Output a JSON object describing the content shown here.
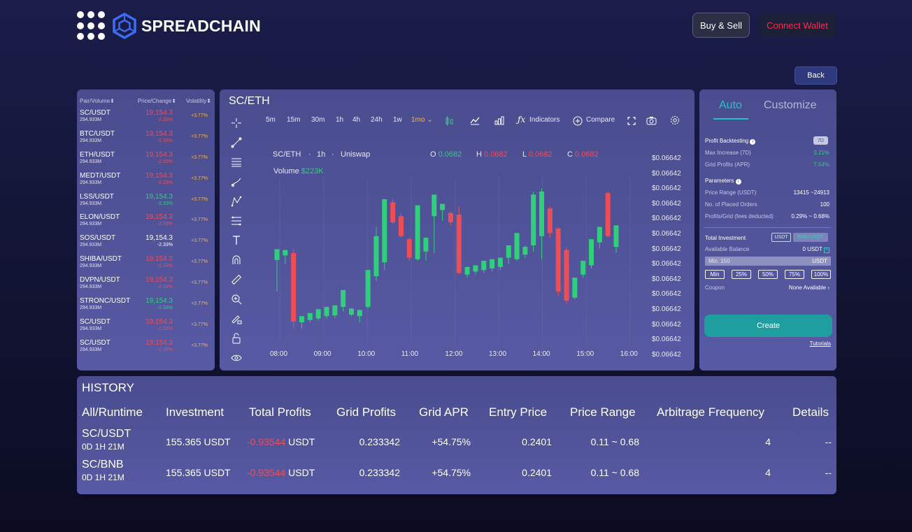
{
  "brand": {
    "name": "SPREADCHAIN"
  },
  "header": {
    "buy_sell": "Buy & Sell",
    "connect_wallet": "Connect Wallet",
    "back": "Back"
  },
  "colors": {
    "up": "#2fcf7b",
    "down": "#ef4d56",
    "accent": "#1f9ea0",
    "warning": "#f2b84a",
    "connect": "#ff2b4a"
  },
  "pairs": {
    "headers": {
      "pair": "Pair",
      "volume": "/Volume",
      "price": "Price",
      "change": "/Change",
      "volatility": "Volatility"
    },
    "rows": [
      {
        "name": "SC/USDT",
        "volume": "294.933M",
        "price": "19,154.3",
        "change": "-2.33%",
        "volatility": "+3.77%",
        "dir": "down"
      },
      {
        "name": "BTC/USDT",
        "volume": "294.933M",
        "price": "19,154.3",
        "change": "-2.33%",
        "volatility": "+3.77%",
        "dir": "down"
      },
      {
        "name": "ETH/USDT",
        "volume": "294.933M",
        "price": "19,154.3",
        "change": "-2.33%",
        "volatility": "+3.77%",
        "dir": "down"
      },
      {
        "name": "MEDT/USDT",
        "volume": "294.933M",
        "price": "19,154.3",
        "change": "-2.33%",
        "volatility": "+3.77%",
        "dir": "down"
      },
      {
        "name": "LSS/USDT",
        "volume": "294.933M",
        "price": "19,154.3",
        "change": "-2.33%",
        "volatility": "+3.77%",
        "dir": "up"
      },
      {
        "name": "ELON/USDT",
        "volume": "294.933M",
        "price": "19,154.3",
        "change": "-2.33%",
        "volatility": "+3.77%",
        "dir": "down"
      },
      {
        "name": "SOS/USDT",
        "volume": "294.933M",
        "price": "19,154.3",
        "change": "-2.33%",
        "volatility": "+3.77%",
        "dir": "white"
      },
      {
        "name": "SHIBA/USDT",
        "volume": "294.933M",
        "price": "19,154.3",
        "change": "-2.33%",
        "volatility": "+3.77%",
        "dir": "down"
      },
      {
        "name": "DVPN/USDT",
        "volume": "294.933M",
        "price": "19,154.3",
        "change": "-2.33%",
        "volatility": "+3.77%",
        "dir": "down"
      },
      {
        "name": "STRONC/USDT",
        "volume": "294.933M",
        "price": "19,154.3",
        "change": "-2.33%",
        "volatility": "+3.77%",
        "dir": "up"
      },
      {
        "name": "SC/USDT",
        "volume": "294.933M",
        "price": "19,154.3",
        "change": "-2.33%",
        "volatility": "+3.77%",
        "dir": "down"
      },
      {
        "name": "SC/USDT",
        "volume": "294.933M",
        "price": "19,154.3",
        "change": "-2.33%",
        "volatility": "+3.77%",
        "dir": "down"
      }
    ]
  },
  "chart": {
    "pair": "SC/ETH",
    "timeframes": [
      "5m",
      "15m",
      "30m",
      "1h",
      "4h",
      "24h",
      "1w",
      "1mo"
    ],
    "active_timeframe": "1mo",
    "indicators_label": "Indicators",
    "compare_label": "Compare",
    "legend": {
      "pair": "SC/ETH",
      "interval": "1h",
      "exchange": "Uniswap",
      "o_label": "O",
      "o": "0.0682",
      "h_label": "H",
      "h": "0.0682",
      "l_label": "L",
      "l": "0.0682",
      "c_label": "C",
      "c": "0.0682",
      "volume_label": "Volume",
      "volume": "$223K"
    }
  },
  "chart_data": {
    "type": "candlestick",
    "x_ticks": [
      "08:00",
      "09:00",
      "10:00",
      "11:00",
      "12:00",
      "13:00",
      "14:00",
      "15:00",
      "16:00"
    ],
    "y_ticks": [
      "$0.06642",
      "$0.06642",
      "$0.06642",
      "$0.06642",
      "$0.06642",
      "$0.06642",
      "$0.06642",
      "$0.06642",
      "$0.06642",
      "$0.06642",
      "$0.06642",
      "$0.06642",
      "$0.06642",
      "$0.06642"
    ],
    "candles": [
      {
        "t": "07:45",
        "o": 0.505,
        "h": 0.575,
        "l": 0.3,
        "c": 0.575,
        "dir": "up"
      },
      {
        "t": "07:51",
        "o": 0.535,
        "h": 0.57,
        "l": 0.48,
        "c": 0.57,
        "dir": "up"
      },
      {
        "t": "08:00",
        "o": 0.55,
        "h": 0.575,
        "l": 0.065,
        "c": 0.105,
        "dir": "down"
      },
      {
        "t": "08:15",
        "o": 0.1,
        "h": 0.14,
        "l": 0.06,
        "c": 0.14,
        "dir": "up"
      },
      {
        "t": "08:25",
        "o": 0.115,
        "h": 0.16,
        "l": 0.1,
        "c": 0.16,
        "dir": "up"
      },
      {
        "t": "08:36",
        "o": 0.125,
        "h": 0.185,
        "l": 0.11,
        "c": 0.185,
        "dir": "up"
      },
      {
        "t": "08:47",
        "o": 0.14,
        "h": 0.2,
        "l": 0.12,
        "c": 0.2,
        "dir": "up"
      },
      {
        "t": "09:00",
        "o": 0.145,
        "h": 0.21,
        "l": 0.13,
        "c": 0.21,
        "dir": "up"
      },
      {
        "t": "09:12",
        "o": 0.2,
        "h": 0.31,
        "l": 0.17,
        "c": 0.31,
        "dir": "up"
      },
      {
        "t": "09:24",
        "o": 0.15,
        "h": 0.19,
        "l": 0.14,
        "c": 0.19,
        "dir": "up"
      },
      {
        "t": "09:35",
        "o": 0.14,
        "h": 0.18,
        "l": 0.1,
        "c": 0.18,
        "dir": "up"
      },
      {
        "t": "09:46",
        "o": 0.2,
        "h": 0.44,
        "l": 0.19,
        "c": 0.44,
        "dir": "up"
      },
      {
        "t": "09:58",
        "o": 0.4,
        "h": 0.72,
        "l": 0.37,
        "c": 0.66,
        "dir": "up"
      },
      {
        "t": "10:10",
        "o": 0.49,
        "h": 0.9,
        "l": 0.44,
        "c": 0.9,
        "dir": "up"
      },
      {
        "t": "10:22",
        "o": 0.88,
        "h": 0.9,
        "l": 0.74,
        "c": 0.75,
        "dir": "down"
      },
      {
        "t": "10:35",
        "o": 0.79,
        "h": 0.81,
        "l": 0.65,
        "c": 0.66,
        "dir": "down"
      },
      {
        "t": "10:47",
        "o": 0.64,
        "h": 0.65,
        "l": 0.5,
        "c": 0.52,
        "dir": "down"
      },
      {
        "t": "10:57",
        "o": 0.51,
        "h": 0.86,
        "l": 0.5,
        "c": 0.86,
        "dir": "up"
      },
      {
        "t": "11:09",
        "o": 0.56,
        "h": 0.65,
        "l": 0.5,
        "c": 0.65,
        "dir": "up"
      },
      {
        "t": "11:20",
        "o": 0.79,
        "h": 0.93,
        "l": 0.55,
        "c": 0.93,
        "dir": "up"
      },
      {
        "t": "11:32",
        "o": 0.87,
        "h": 0.87,
        "l": 0.76,
        "c": 0.83,
        "dir": "up"
      },
      {
        "t": "11:43",
        "o": 0.81,
        "h": 0.82,
        "l": 0.73,
        "c": 0.75,
        "dir": "down"
      },
      {
        "t": "11:54",
        "o": 0.8,
        "h": 0.85,
        "l": 0.41,
        "c": 0.42,
        "dir": "down"
      },
      {
        "t": "12:06",
        "o": 0.41,
        "h": 0.46,
        "l": 0.39,
        "c": 0.46,
        "dir": "up"
      },
      {
        "t": "12:17",
        "o": 0.43,
        "h": 0.47,
        "l": 0.41,
        "c": 0.47,
        "dir": "up"
      },
      {
        "t": "12:29",
        "o": 0.44,
        "h": 0.5,
        "l": 0.42,
        "c": 0.5,
        "dir": "up"
      },
      {
        "t": "12:40",
        "o": 0.45,
        "h": 0.51,
        "l": 0.43,
        "c": 0.51,
        "dir": "up"
      },
      {
        "t": "12:52",
        "o": 0.46,
        "h": 0.52,
        "l": 0.44,
        "c": 0.52,
        "dir": "up"
      },
      {
        "t": "13:04",
        "o": 0.52,
        "h": 0.6,
        "l": 0.48,
        "c": 0.6,
        "dir": "up"
      },
      {
        "t": "13:15",
        "o": 0.51,
        "h": 0.68,
        "l": 0.5,
        "c": 0.68,
        "dir": "up"
      },
      {
        "t": "13:27",
        "o": 0.54,
        "h": 0.6,
        "l": 0.52,
        "c": 0.59,
        "dir": "up"
      },
      {
        "t": "13:38",
        "o": 0.6,
        "h": 0.95,
        "l": 0.56,
        "c": 0.93,
        "dir": "up"
      },
      {
        "t": "13:49",
        "o": 0.95,
        "h": 0.97,
        "l": 0.51,
        "c": 0.66,
        "dir": "up"
      },
      {
        "t": "14:00",
        "o": 0.84,
        "h": 0.85,
        "l": 0.65,
        "c": 0.68,
        "dir": "down"
      },
      {
        "t": "14:12",
        "o": 0.71,
        "h": 0.72,
        "l": 0.27,
        "c": 0.3,
        "dir": "down"
      },
      {
        "t": "14:24",
        "o": 0.57,
        "h": 0.59,
        "l": 0.22,
        "c": 0.24,
        "dir": "down"
      },
      {
        "t": "14:35",
        "o": 0.26,
        "h": 0.39,
        "l": 0.25,
        "c": 0.39,
        "dir": "up"
      },
      {
        "t": "14:47",
        "o": 0.41,
        "h": 0.5,
        "l": 0.39,
        "c": 0.5,
        "dir": "up"
      },
      {
        "t": "14:58",
        "o": 0.47,
        "h": 0.64,
        "l": 0.45,
        "c": 0.64,
        "dir": "up"
      },
      {
        "t": "15:10",
        "o": 0.62,
        "h": 0.72,
        "l": 0.58,
        "c": 0.72,
        "dir": "up"
      },
      {
        "t": "15:21",
        "o": 0.94,
        "h": 0.95,
        "l": 0.65,
        "c": 0.66,
        "dir": "down"
      },
      {
        "t": "15:32",
        "o": 0.59,
        "h": 0.73,
        "l": 0.55,
        "c": 0.73,
        "dir": "up"
      }
    ]
  },
  "right_panel": {
    "tabs": [
      "Auto",
      "Customize"
    ],
    "profit_backtesting": "Profit Backtesting",
    "period": "7D",
    "max_increase_label": "Max Increase (7D)",
    "max_increase": "3.21%",
    "grid_profits_label": "Grid Profits (APR)",
    "grid_profits": "7.54%",
    "parameters": "Parameters",
    "price_range_label": "Price Range (USDT)",
    "price_range": "13415 ~24913",
    "placed_orders_label": "No. of Placed Orders",
    "placed_orders": "100",
    "profits_grid_label": "Profits/Grid (fees deducted)",
    "profits_grid": "0.29% ~ 0.68%",
    "total_investment": "Total Investment",
    "currency_a": "USDT",
    "currency_b": "BNB+USDT",
    "available_balance_label": "Available Balance",
    "available_balance": "0 USDT",
    "amount_placeholder": "Min. 150",
    "amount_unit": "USDT",
    "pct_buttons": [
      "Min",
      "25%",
      "50%",
      "75%",
      "100%"
    ],
    "coupon_label": "Coupon",
    "coupon_value": "None Available",
    "create": "Create",
    "tutorials": "Tutorials"
  },
  "history": {
    "title": "HISTORY",
    "columns": [
      "All/Runtime",
      "Investment",
      "Total Profits",
      "Grid Profits",
      "Grid APR",
      "Entry Price",
      "Price Range",
      "Arbitrage Frequency",
      "Details"
    ],
    "rows": [
      {
        "pair": "SC/USDT",
        "runtime": "0D 1H 21M",
        "investment": "155.365 USDT",
        "total_profit": "-0.93544",
        "total_unit": "USDT",
        "grid_profits": "0.233342",
        "grid_apr": "+54.75%",
        "entry": "0.2401",
        "range": "0.11 ~ 0.68",
        "freq": "4",
        "details": "--"
      },
      {
        "pair": "SC/BNB",
        "runtime": "0D 1H 21M",
        "investment": "155.365 USDT",
        "total_profit": "-0.93544",
        "total_unit": "USDT",
        "grid_profits": "0.233342",
        "grid_apr": "+54.75%",
        "entry": "0.2401",
        "range": "0.11 ~ 0.68",
        "freq": "4",
        "details": "--"
      }
    ]
  }
}
